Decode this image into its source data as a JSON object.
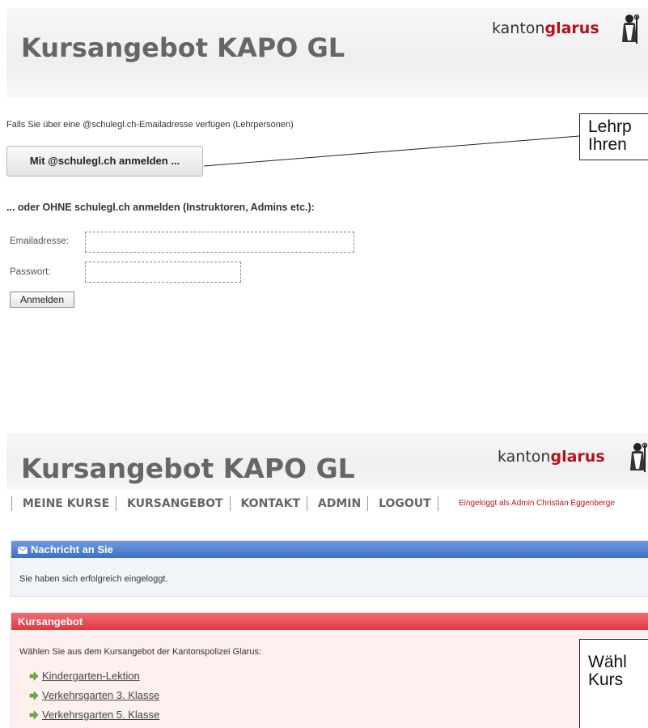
{
  "header1": {
    "title": "Kursangebot KAPO GL",
    "brand_prefix": "kanton",
    "brand_name": "glarus",
    "emblem_icon": "canton-emblem-icon"
  },
  "login": {
    "hint": "Falls Sie über eine @schulegl.ch-Emailadresse verfügen (Lehrpersonen)",
    "school_button": "Mit @schulegl.ch anmelden ...",
    "or_heading": "... oder OHNE schulegl.ch anmelden (Instruktoren, Admins etc.):",
    "email_label": "Emailadresse:",
    "email_value": "",
    "password_label": "Passwort:",
    "password_value": "",
    "submit": "Anmelden"
  },
  "callout1": {
    "line1": "Lehrp",
    "line2": "Ihren"
  },
  "header2": {
    "title": "Kursangebot KAPO GL",
    "brand_prefix": "kanton",
    "brand_name": "glarus",
    "emblem_icon": "canton-emblem-icon"
  },
  "nav": {
    "items": [
      "MEINE KURSE",
      "KURSANGEBOT",
      "KONTAKT",
      "ADMIN",
      "LOGOUT"
    ],
    "logged_in": "Eingeloggt als Admin Christian Eggenberge"
  },
  "message_panel": {
    "title": "Nachricht an Sie",
    "icon": "envelope-icon",
    "text": "Sie haben sich erfolgreich eingeloggt."
  },
  "course_panel": {
    "title": "Kursangebot",
    "intro": "Wählen Sie aus dem Kursangebot der Kantonspolizei Glarus:",
    "courses": [
      "Kindergarten-Lektion",
      "Verkehrsgarten 3. Klasse",
      "Verkehrsgarten 5. Klasse"
    ],
    "item_icon": "green-arrow-icon"
  },
  "callout2": {
    "line1": "Wähl",
    "line2": "Kurs"
  },
  "colors": {
    "red_bar": "#e0383f",
    "blue_bar": "#3d6fc4",
    "brand_red": "#b1121a"
  }
}
